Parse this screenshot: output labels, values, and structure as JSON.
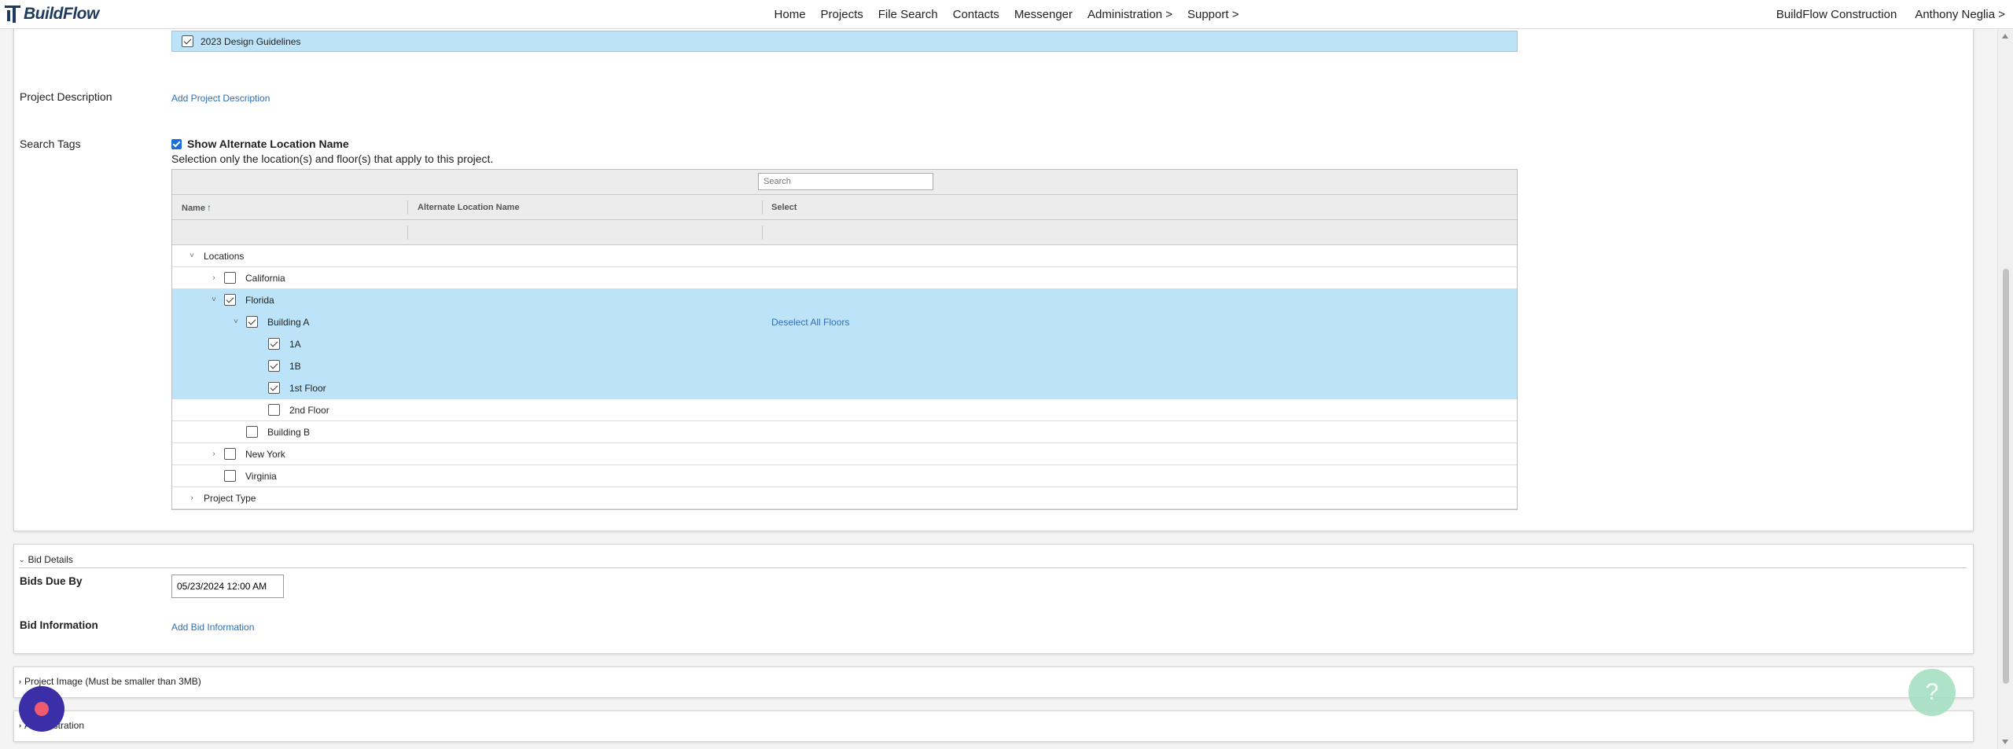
{
  "app": {
    "logo_text": "BuildFlow"
  },
  "nav": {
    "items": [
      "Home",
      "Projects",
      "File Search",
      "Contacts",
      "Messenger",
      "Administration >",
      "Support >"
    ],
    "company": "BuildFlow Construction",
    "user": "Anthony Neglia >"
  },
  "guideline": {
    "label": "2023 Design Guidelines",
    "checked": true
  },
  "project_description": {
    "label": "Project Description",
    "link": "Add Project Description"
  },
  "search_tags": {
    "label": "Search Tags",
    "show_alt_label": "Show Alternate Location Name",
    "hint": "Selection only the location(s) and floor(s) that apply to this project.",
    "search_placeholder": "Search",
    "columns": [
      "Name",
      "Alternate Location Name",
      "Select"
    ],
    "sort_indicator": "↑",
    "tree": [
      {
        "label": "Locations",
        "level": 0,
        "chevron": "down",
        "checkbox": false
      },
      {
        "label": "California",
        "level": 1,
        "chevron": "right",
        "checkbox": true,
        "checked": false,
        "selected": false
      },
      {
        "label": "Florida",
        "level": 1,
        "chevron": "down",
        "checkbox": true,
        "checked": true,
        "selected": true
      },
      {
        "label": "Building A",
        "level": 2,
        "chevron": "down",
        "checkbox": true,
        "checked": true,
        "selected": true,
        "action": "Deselect All Floors"
      },
      {
        "label": "1A",
        "level": 3,
        "chevron": "none",
        "checkbox": true,
        "checked": true,
        "selected": true
      },
      {
        "label": "1B",
        "level": 3,
        "chevron": "none",
        "checkbox": true,
        "checked": true,
        "selected": true
      },
      {
        "label": "1st Floor",
        "level": 3,
        "chevron": "none",
        "checkbox": true,
        "checked": true,
        "selected": true
      },
      {
        "label": "2nd Floor",
        "level": 3,
        "chevron": "none",
        "checkbox": true,
        "checked": false,
        "selected": false
      },
      {
        "label": "Building B",
        "level": 2,
        "chevron": "none",
        "checkbox": true,
        "checked": false,
        "selected": false
      },
      {
        "label": "New York",
        "level": 1,
        "chevron": "right",
        "checkbox": true,
        "checked": false,
        "selected": false
      },
      {
        "label": "Virginia",
        "level": 1,
        "chevron": "none",
        "checkbox": true,
        "checked": false,
        "selected": false
      },
      {
        "label": "Project Type",
        "level": 0,
        "chevron": "right",
        "checkbox": false
      }
    ]
  },
  "bid_details": {
    "section_title": "Bid Details",
    "bids_due_label": "Bids Due By",
    "bids_due_value": "05/23/2024 12:00 AM",
    "bid_info_label": "Bid Information",
    "bid_info_link": "Add Bid Information"
  },
  "sections": {
    "project_image": "Project Image (Must be smaller than 3MB)",
    "administration": "Administration"
  },
  "widgets": {
    "help_icon": "?"
  },
  "colors": {
    "brand": "#1f3a5f",
    "selected_row": "#bde3f8",
    "link": "#2f6fb8",
    "help_button": "#a6e0c2",
    "record_button": "#3b2fa8"
  }
}
